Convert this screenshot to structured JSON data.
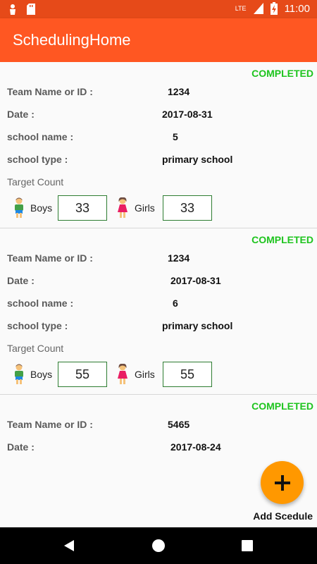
{
  "status_bar": {
    "time": "11:00",
    "network": "LTE"
  },
  "app_bar": {
    "title": "SchedulingHome"
  },
  "labels": {
    "team": "Team Name or ID :",
    "date": "Date :",
    "school_name": "school name :",
    "school_type": "school type :",
    "target_count": "Target Count",
    "boys": "Boys",
    "girls": "Girls"
  },
  "cards": [
    {
      "status": "COMPLETED",
      "team": "1234",
      "date": "2017-08-31",
      "school_name": "5",
      "school_type": "primary school",
      "boys": "33",
      "girls": "33"
    },
    {
      "status": "COMPLETED",
      "team": "1234",
      "date": "2017-08-31",
      "school_name": "6",
      "school_type": "primary school",
      "boys": "55",
      "girls": "55"
    },
    {
      "status": "COMPLETED",
      "team": "5465",
      "date": "2017-08-24"
    }
  ],
  "fab": {
    "label": "Add Scedule",
    "icon": "plus-icon"
  },
  "colors": {
    "status_bar": "#e64a19",
    "app_bar": "#ff5722",
    "completed": "#1ec41e",
    "fab": "#ff9800",
    "count_border": "#2e7d32"
  }
}
